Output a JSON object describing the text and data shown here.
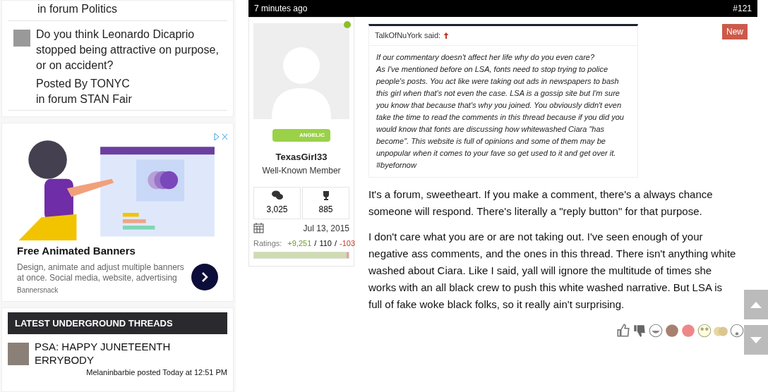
{
  "sidebar": {
    "threads": [
      {
        "lines": [
          "in forum Politics"
        ]
      },
      {
        "title": "Do you think Leonardo Dicaprio stopped being attractive on purpose, or on accident?",
        "posted_by": "Posted By TONYC",
        "forum": "in forum STAN Fair"
      }
    ],
    "ad": {
      "title": "Free Animated Banners",
      "description": "Design, animate and adjust multiple banners at once. Social media, website, advertising",
      "sponsor": "Bannersnack"
    },
    "underground": {
      "heading": "LATEST UNDERGROUND THREADS",
      "threads": [
        {
          "title": "PSA: HAPPY JUNETEENTH ERRYBODY",
          "meta": "Melaninbarbie posted Today at 12:51 PM"
        }
      ]
    }
  },
  "post": {
    "time": "7 minutes ago",
    "number": "#121",
    "author": {
      "online": true,
      "badge": "ANGELIC",
      "name": "TexasGirl33",
      "role": "Well-Known Member",
      "messages": "3,025",
      "trophies": "885",
      "joined": "Jul 13, 2015",
      "ratings_label": "Ratings:",
      "separator": "/",
      "positive": "+9,251",
      "neutral": "110",
      "negative": "-103",
      "level": 0.98
    },
    "new_badge": "New",
    "quote": {
      "author": "TalkOfNuYork said:",
      "text": "If our commentary doesn't affect her life why do you even care?\nAs I've mentioned before on LSA, fonts need to stop trying to police people's posts. You act like were taking out ads in newspapers to bash this girl when that's not even the case. LSA is a gossip site but I'm sure you know that because that's why you joined. You obviously didn't even take the time to read the comments in this thread because if you did you would know that fonts are discussing how whitewashed Ciara \"has become\". This website is full of opinions and some of them may be unpopular when it comes to your fave so get used to it and get over it. #byefornow"
    },
    "paragraphs": [
      "It's a forum, sweetheart. If you make a comment, there's a always chance someone will respond. There's literally a \"reply button\" for that purpose.",
      "I don't care what you are or are not taking out. I've seen enough of your negative ass comments, and the ones in this thread. There isn't anything white washed about Ciara. Like I said, yall will ignore the multitude of times she works with an all black crew to push this white washed narrative. But LSA is full of fake woke black folks, so it really ain't surprising."
    ]
  }
}
